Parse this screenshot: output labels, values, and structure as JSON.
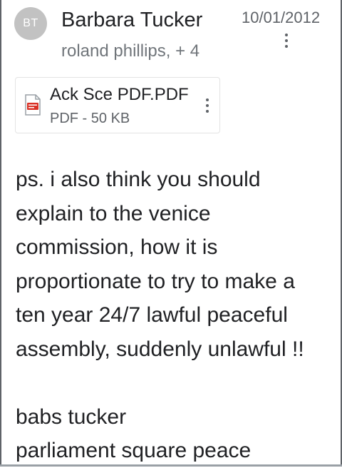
{
  "message": {
    "avatar_initials": "BT",
    "sender_name": "Barbara Tucker",
    "date": "10/01/2012",
    "recipients": "roland phillips, + 4",
    "attachment": {
      "icon": "pdf-file-icon",
      "name": "Ack Sce PDF.PDF",
      "meta": "PDF - 50 KB"
    },
    "body_lines": [
      "ps. i also think you should",
      "explain to the venice",
      "commission, how it is",
      "proportionate to try to make a",
      "ten year 24/7 lawful peaceful",
      "assembly, suddenly unlawful !!"
    ],
    "signature_lines": [
      "babs tucker",
      "parliament square peace"
    ]
  },
  "colors": {
    "avatar_bg": "#c2c2c2",
    "pdf_red": "#d93025",
    "text_primary": "#202124",
    "text_secondary": "#5f6368"
  }
}
